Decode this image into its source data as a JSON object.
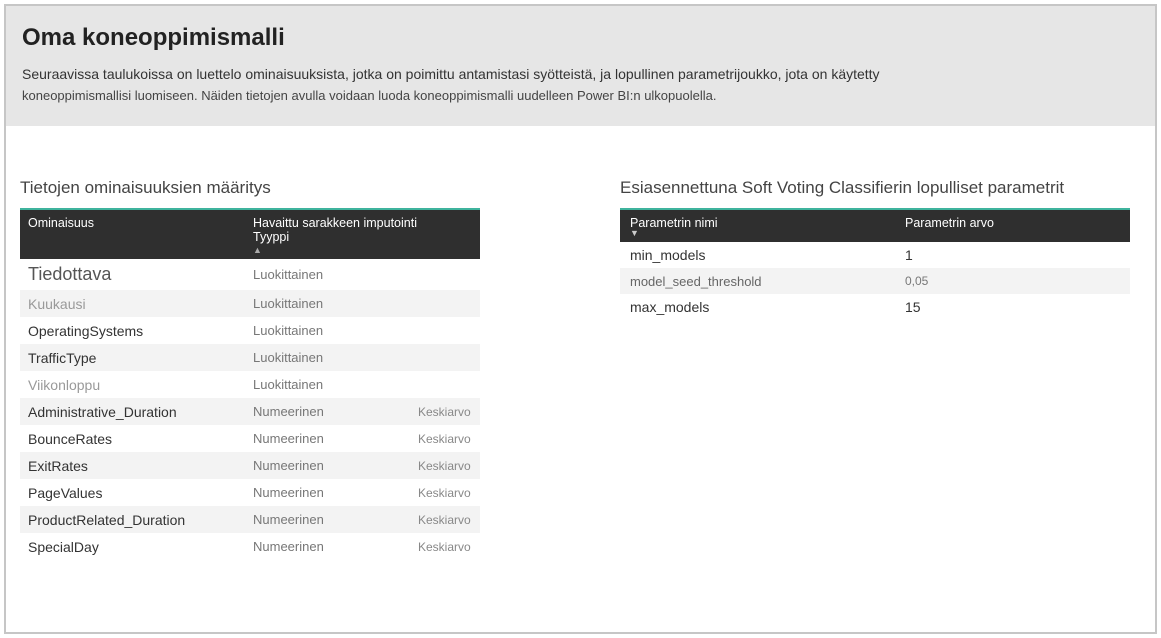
{
  "header": {
    "title": "Oma koneoppimismalli",
    "description_line1": "Seuraavissa taulukoissa on luettelo ominaisuuksista, jotka on poimittu antamistasi syötteistä, ja lopullinen parametrijoukko, jota on käytetty",
    "description_line2": "koneoppimismallisi luomiseen. Näiden tietojen avulla voidaan luoda koneoppimismalli uudelleen Power BI:n ulkopuolella."
  },
  "left": {
    "section_title": "Tietojen ominaisuuksien määritys",
    "columns": {
      "feature": "Ominaisuus",
      "detected_line1": "Havaittu sarakkeen imputointi",
      "detected_line2": "Tyyppi"
    },
    "rows": [
      {
        "feature": "Tiedottava",
        "type": "Luokittainen",
        "imputation": ""
      },
      {
        "feature": "Kuukausi",
        "type": "Luokittainen",
        "imputation": ""
      },
      {
        "feature": "OperatingSystems",
        "type": "Luokittainen",
        "imputation": ""
      },
      {
        "feature": "TrafficType",
        "type": "Luokittainen",
        "imputation": ""
      },
      {
        "feature": "Viikonloppu",
        "type": "Luokittainen",
        "imputation": ""
      },
      {
        "feature": "Administrative_Duration",
        "type": "Numeerinen",
        "imputation": "Keskiarvo"
      },
      {
        "feature": "BounceRates",
        "type": "Numeerinen",
        "imputation": "Keskiarvo"
      },
      {
        "feature": "ExitRates",
        "type": "Numeerinen",
        "imputation": "Keskiarvo"
      },
      {
        "feature": "PageValues",
        "type": "Numeerinen",
        "imputation": "Keskiarvo"
      },
      {
        "feature": "ProductRelated_Duration",
        "type": "Numeerinen",
        "imputation": "Keskiarvo"
      },
      {
        "feature": "SpecialDay",
        "type": "Numeerinen",
        "imputation": "Keskiarvo"
      }
    ]
  },
  "right": {
    "section_title": "Esiasennettuna Soft Voting Classifierin lopulliset parametrit",
    "columns": {
      "name": "Parametrin nimi",
      "value": "Parametrin arvo"
    },
    "rows": [
      {
        "name": "min_models",
        "value": "1"
      },
      {
        "name": "model_seed_threshold",
        "value": "0,05"
      },
      {
        "name": "max_models",
        "value": "15"
      }
    ]
  }
}
